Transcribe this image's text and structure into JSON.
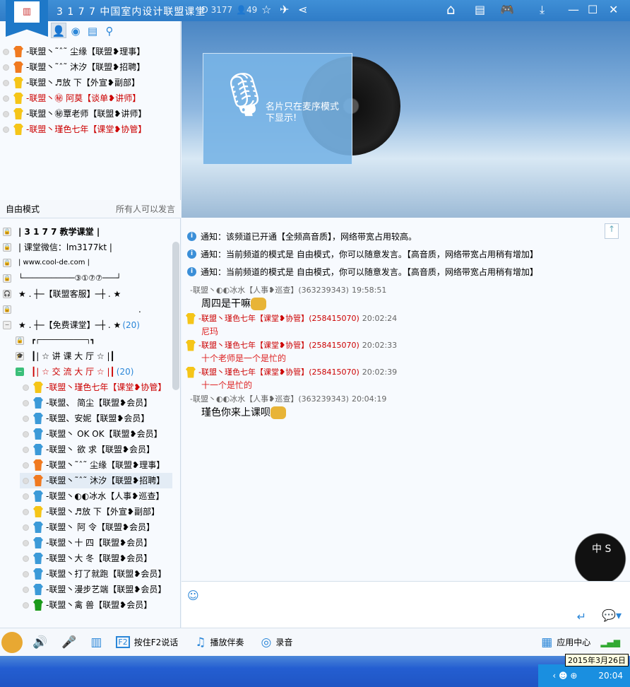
{
  "window": {
    "title": "3 1 7 7 中国室内设计联盟课堂",
    "id_label": "ID 3177",
    "online_count": "49"
  },
  "colors": {
    "accent": "#2a86d8",
    "red_text": "#cc0000",
    "topbar": "#3584cd"
  },
  "user_list": [
    {
      "name": "-联盟丶˜ˆ˜  尘缘",
      "role": "【联盟❥理事】",
      "red": false,
      "shirt": "#f07a20"
    },
    {
      "name": "-联盟丶˜ˆ˜  沐汐",
      "role": "【联盟❥招聘】",
      "red": false,
      "shirt": "#f07a20"
    },
    {
      "name": "-联盟丶♬放  下",
      "role": "【外宣❥副部】",
      "red": false,
      "shirt": "#f5c518"
    },
    {
      "name": "-联盟丶㊙  阿莫",
      "role": "【谈单❥讲师】",
      "red": true,
      "shirt": "#f5c518"
    },
    {
      "name": "-联盟丶㊙覃老师",
      "role": "【联盟❥讲师】",
      "red": false,
      "shirt": "#f5c518"
    },
    {
      "name": "-联盟丶瑾色七年",
      "role": "【课堂❥协管】",
      "red": true,
      "shirt": "#f5c518"
    }
  ],
  "mode": {
    "name": "自由模式",
    "desc": "所有人可以发言"
  },
  "channels": {
    "header": [
      "|        3 1 7 7 教学课堂        |",
      "|      课堂微信：lm3177kt      |",
      "|       www.cool-de.com       |",
      "└───────────③①⑦⑦───┘"
    ],
    "service": "★ . ┼─【联盟客服】─┼ . ★",
    "dot": ".",
    "free": {
      "label": "★ . ┼─【免费课堂】─┼ . ★",
      "count": "(20)"
    },
    "sub_top": "┏┌───────────┐┓",
    "lecture": "┃| ☆ 讲 课  大 厅  ☆ |┃",
    "exchange": {
      "label": "┃| ☆ 交 流  大 厅  ☆ |┃",
      "count": "(20)"
    }
  },
  "members": [
    {
      "name": "-联盟丶瑾色七年",
      "role": "【课堂❥协管】",
      "red": true,
      "shirt": "#f5c518"
    },
    {
      "name": "-联盟、  简尘",
      "role": "【联盟❥会员】",
      "red": false,
      "shirt": "#3c9ad8"
    },
    {
      "name": "-联盟、安妮",
      "role": "【联盟❥会员】",
      "red": false,
      "shirt": "#3c9ad8"
    },
    {
      "name": "-联盟丶  OK  OK",
      "role": "【联盟❥会员】",
      "red": false,
      "shirt": "#3c9ad8"
    },
    {
      "name": "-联盟丶 欲   求",
      "role": "【联盟❥会员】",
      "red": false,
      "shirt": "#3c9ad8"
    },
    {
      "name": "-联盟丶˜ˆ˜  尘缘",
      "role": "【联盟❥理事】",
      "red": false,
      "shirt": "#f07a20"
    },
    {
      "name": "-联盟丶˜ˆ˜  沐汐",
      "role": "【联盟❥招聘】",
      "red": false,
      "shirt": "#f07a20"
    },
    {
      "name": "-联盟丶◐◐冰水",
      "role": "【人事❥巡查】",
      "red": false,
      "shirt": "#3c9ad8"
    },
    {
      "name": "-联盟丶♬放  下",
      "role": "【外宣❥副部】",
      "red": false,
      "shirt": "#f5c518"
    },
    {
      "name": "-联盟丶  阿  令",
      "role": "【联盟❥会员】",
      "red": false,
      "shirt": "#3c9ad8"
    },
    {
      "name": "-联盟丶十  四",
      "role": "【联盟❥会员】",
      "red": false,
      "shirt": "#3c9ad8"
    },
    {
      "name": "-联盟丶大   冬",
      "role": "【联盟❥会员】",
      "red": false,
      "shirt": "#3c9ad8"
    },
    {
      "name": "-联盟丶打了就跑",
      "role": "【联盟❥会员】",
      "red": false,
      "shirt": "#3c9ad8"
    },
    {
      "name": "-联盟丶漫步艺端",
      "role": "【联盟❥会员】",
      "red": false,
      "shirt": "#3c9ad8"
    },
    {
      "name": "-联盟丶禽    兽",
      "role": "【联盟❥会员】",
      "red": false,
      "shirt": "#1a9a1a"
    }
  ],
  "banner": {
    "card_text_1": "名片只在麦序模式",
    "card_text_2": "下显示!"
  },
  "notices": [
    "通知：该频道已开通【全频高音质】，网络带宽占用较高。",
    "通知：当前频道的模式是 自由模式，你可以随意发言。【高音质，网络带宽占用稍有增加】",
    "通知：当前频道的模式是 自由模式，你可以随意发言。【高音质，网络带宽占用稍有增加】"
  ],
  "messages": [
    {
      "sender": "-联盟丶◐◐冰水【人事❥巡查】",
      "uid": "(363239343)",
      "time": "19:58:51",
      "text": "周四是干嘛",
      "red": false
    },
    {
      "sender": "-联盟丶瑾色七年【课堂❥协管】",
      "uid": "(258415070)",
      "time": "20:02:24",
      "text": "尼玛",
      "red": true
    },
    {
      "sender": "-联盟丶瑾色七年【课堂❥协管】",
      "uid": "(258415070)",
      "time": "20:02:33",
      "text": "十个老师是一个是忙的",
      "red": true
    },
    {
      "sender": "-联盟丶瑾色七年【课堂❥协管】",
      "uid": "(258415070)",
      "time": "20:02:39",
      "text": "十一个是忙的",
      "red": true
    },
    {
      "sender": "-联盟丶◐◐冰水【人事❥巡查】",
      "uid": "(363239343)",
      "time": "20:04:19",
      "text": "瑾色你来上课呗",
      "red": false
    }
  ],
  "toolbar": {
    "ptt": "按住F2说话",
    "accompany": "播放伴奏",
    "record": "录音",
    "app_center": "应用中心"
  },
  "taskbar": {
    "date": "2015年3月26日",
    "time": "20:04"
  }
}
